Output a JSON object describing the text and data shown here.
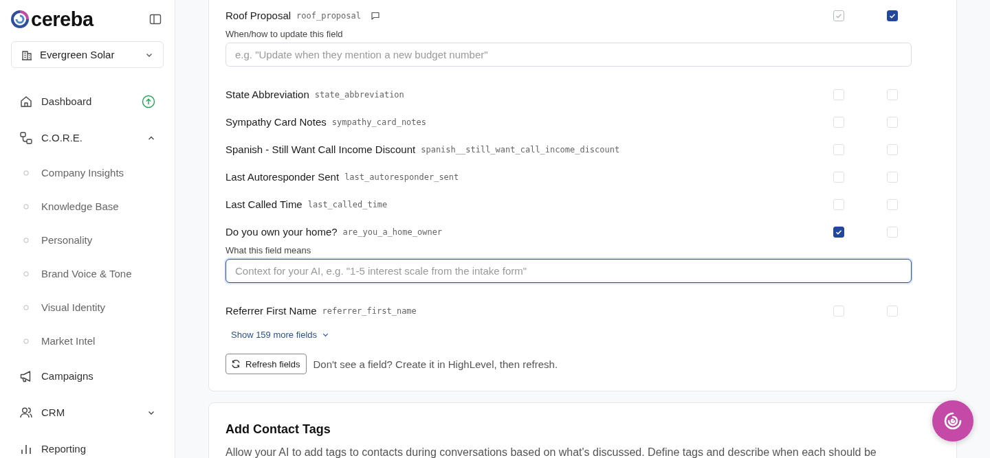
{
  "brand": {
    "name": "cereba"
  },
  "workspace": {
    "name": "Evergreen Solar"
  },
  "nav": [
    {
      "kind": "link",
      "label": "Dashboard"
    },
    {
      "kind": "group",
      "label": "C.O.R.E.",
      "expanded": true,
      "children": [
        {
          "label": "Company Insights"
        },
        {
          "label": "Knowledge Base"
        },
        {
          "label": "Personality"
        },
        {
          "label": "Brand Voice & Tone"
        },
        {
          "label": "Visual Identity"
        },
        {
          "label": "Market Intel"
        }
      ]
    },
    {
      "kind": "link",
      "label": "Campaigns"
    },
    {
      "kind": "group",
      "label": "CRM",
      "expanded": false
    },
    {
      "kind": "link",
      "label": "Reporting"
    }
  ],
  "fields": [
    {
      "label": "Roof Proposal",
      "key": "roof_proposal",
      "note": true,
      "read": {
        "checked": true,
        "disabled": true
      },
      "write": {
        "checked": true,
        "disabled": false
      },
      "editor": {
        "label": "When/how to update this field",
        "placeholder": "e.g. \"Update when they mention a new budget number\"",
        "focused": false
      }
    },
    {
      "label": "State Abbreviation",
      "key": "state_abbreviation",
      "note": false,
      "read": {
        "checked": false,
        "disabled": false
      },
      "write": {
        "checked": false,
        "disabled": false
      }
    },
    {
      "label": "Sympathy Card Notes",
      "key": "sympathy_card_notes",
      "note": false,
      "read": {
        "checked": false,
        "disabled": false
      },
      "write": {
        "checked": false,
        "disabled": false
      }
    },
    {
      "label": "Spanish - Still Want Call Income Discount",
      "key": "spanish__still_want_call_income_discount",
      "note": false,
      "read": {
        "checked": false,
        "disabled": false
      },
      "write": {
        "checked": false,
        "disabled": false
      }
    },
    {
      "label": "Last Autoresponder Sent",
      "key": "last_autoresponder_sent",
      "note": false,
      "read": {
        "checked": false,
        "disabled": false
      },
      "write": {
        "checked": false,
        "disabled": false
      }
    },
    {
      "label": "Last Called Time",
      "key": "last_called_time",
      "note": false,
      "read": {
        "checked": false,
        "disabled": false
      },
      "write": {
        "checked": false,
        "disabled": false
      }
    },
    {
      "label": "Do you own your home?",
      "key": "are_you_a_home_owner",
      "note": false,
      "read": {
        "checked": true,
        "disabled": false
      },
      "write": {
        "checked": false,
        "disabled": false
      },
      "editor": {
        "label": "What this field means",
        "placeholder": "Context for your AI, e.g. \"1-5 interest scale from the intake form\"",
        "focused": true
      }
    },
    {
      "label": "Referrer First Name",
      "key": "referrer_first_name",
      "note": false,
      "read": {
        "checked": false,
        "disabled": false
      },
      "write": {
        "checked": false,
        "disabled": false
      }
    }
  ],
  "show_more": "Show 159 more fields",
  "refresh": {
    "button": "Refresh fields",
    "hint": "Don't see a field? Create it in HighLevel, then refresh."
  },
  "tags_card": {
    "title": "Add Contact Tags",
    "description": "Allow your AI to add tags to contacts during conversations based on what's discussed. Define tags and describe when each should be"
  }
}
